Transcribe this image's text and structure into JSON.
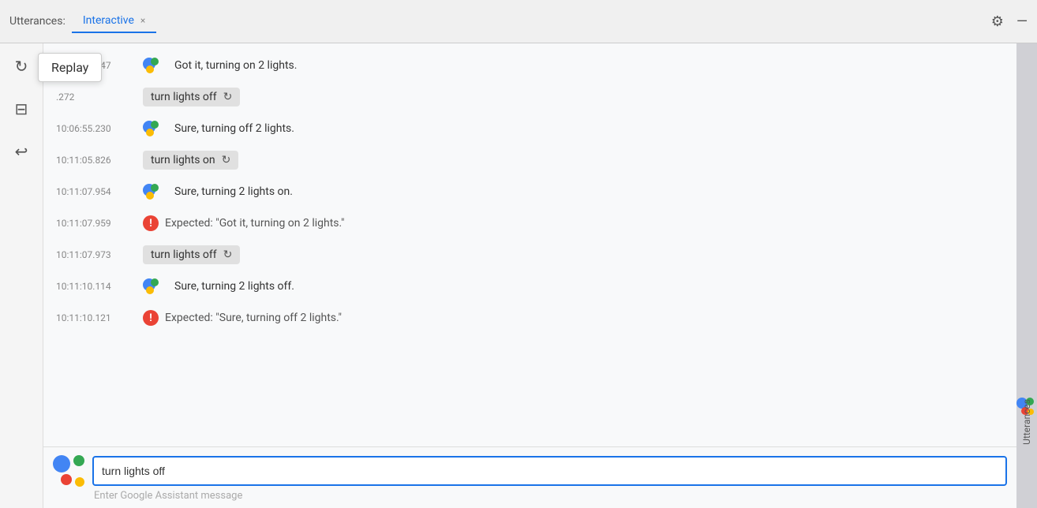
{
  "titleBar": {
    "label": "Utterances:",
    "tab": {
      "name": "Interactive",
      "closeLabel": "×"
    },
    "settingsIcon": "⚙",
    "minimizeIcon": "—"
  },
  "toolbar": {
    "replayIcon": "↻",
    "saveIcon": "⊞",
    "undoIcon": "↩",
    "replayTooltip": "Replay"
  },
  "messages": [
    {
      "id": 1,
      "timestamp": "10:04:36.247",
      "type": "assistant",
      "text": "Got it, turning on 2 lights."
    },
    {
      "id": 2,
      "timestamp": ".272",
      "type": "user",
      "text": "turn lights off"
    },
    {
      "id": 3,
      "timestamp": "10:06:55.230",
      "type": "assistant",
      "text": "Sure, turning off 2 lights."
    },
    {
      "id": 4,
      "timestamp": "10:11:05.826",
      "type": "user",
      "text": "turn lights on"
    },
    {
      "id": 5,
      "timestamp": "10:11:07.954",
      "type": "assistant",
      "text": "Sure, turning 2 lights on."
    },
    {
      "id": 6,
      "timestamp": "10:11:07.959",
      "type": "expected",
      "text": "Expected: \"Got it, turning on 2 lights.\""
    },
    {
      "id": 7,
      "timestamp": "10:11:07.973",
      "type": "user",
      "text": "turn lights off"
    },
    {
      "id": 8,
      "timestamp": "10:11:10.114",
      "type": "assistant",
      "text": "Sure, turning 2 lights off."
    },
    {
      "id": 9,
      "timestamp": "10:11:10.121",
      "type": "expected",
      "text": "Expected: \"Sure, turning off 2 lights.\""
    }
  ],
  "input": {
    "value": "turn lights off",
    "placeholder": "Enter Google Assistant message"
  },
  "sidebar": {
    "label": "Utterances"
  }
}
